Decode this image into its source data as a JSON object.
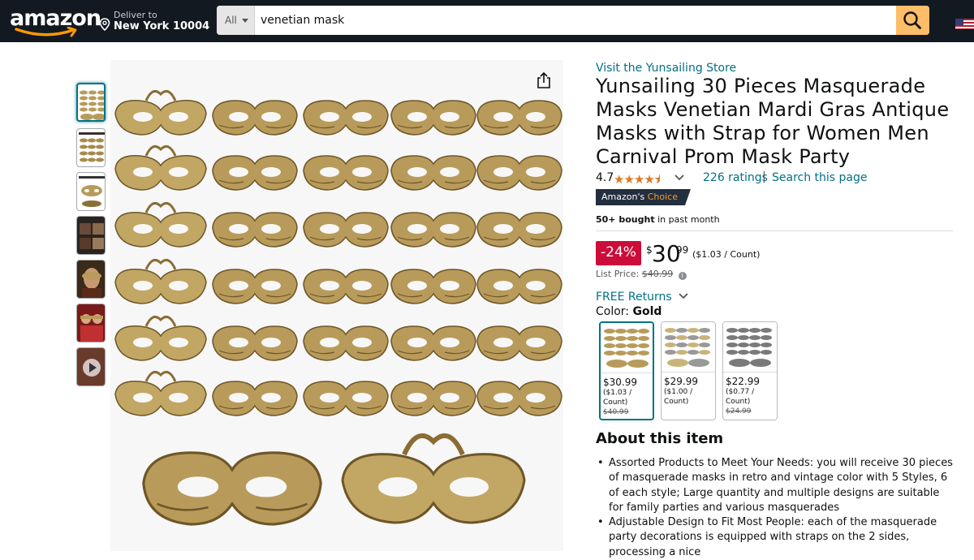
{
  "header": {
    "logo_text": "amazon",
    "deliver_line1": "Deliver to",
    "deliver_line2": "New York 10004",
    "search_category": "All",
    "search_query": "venetian mask"
  },
  "product": {
    "store_link": "Visit the Yunsailing Store",
    "title": "Yunsailing 30 Pieces Masquerade Masks Venetian Mardi Gras Antique Masks with Strap for Women Men Carnival Prom Mask Party",
    "rating": "4.7",
    "stars": "★★★★⯨",
    "ratings_count": "226 ratings",
    "separator": "|",
    "search_page": "Search this page",
    "badge_prefix": "Amazon's",
    "badge_suffix": "Choice",
    "bought_bold": "50+ bought",
    "bought_rest": " in past month",
    "discount": "-24%",
    "price_symbol": "$",
    "price_whole": "30",
    "price_fraction": "99",
    "price_unit": "($1.03 / Count)",
    "list_price_label": "List Price:",
    "list_price": "$40.99",
    "free_returns": "FREE Returns",
    "color_label": "Color:",
    "color_value": "Gold",
    "swatches": [
      {
        "price": "$30.99",
        "unit": "($1.03 / Count)",
        "list": "$40.99"
      },
      {
        "price": "$29.99",
        "unit": "($1.00 / Count)",
        "list": ""
      },
      {
        "price": "$22.99",
        "unit": "($0.77 / Count)",
        "list": "$24.99"
      }
    ],
    "about_heading": "About this item",
    "bullets": [
      "Assorted Products to Meet Your Needs: you will receive 30 pieces of masquerade masks in retro and vintage color with 5 Styles, 6 of each style; Large quantity and multiple designs are suitable for family parties and various masquerades",
      "Adjustable Design to Fit Most People: each of the masquerade party decorations is equipped with straps on the 2 sides, processing a nice"
    ]
  },
  "colors": {
    "nav_bg": "#131921",
    "link": "#007185",
    "deal_red": "#cc0c39",
    "star": "#de7921",
    "search_button": "#febd69",
    "mask_gold": "#b89b5a"
  }
}
